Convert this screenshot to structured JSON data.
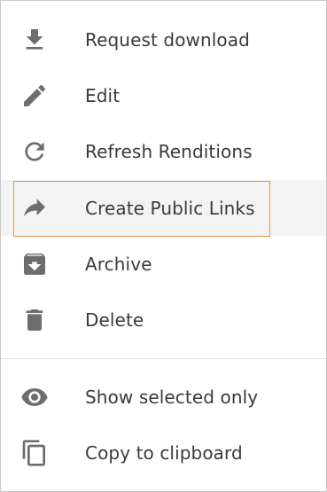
{
  "menu": {
    "items": [
      {
        "label": "Request download",
        "icon": "download-icon"
      },
      {
        "label": "Edit",
        "icon": "pencil-icon"
      },
      {
        "label": "Refresh Renditions",
        "icon": "refresh-icon"
      },
      {
        "label": "Create Public Links",
        "icon": "share-arrow-icon"
      },
      {
        "label": "Archive",
        "icon": "archive-icon"
      },
      {
        "label": "Delete",
        "icon": "trash-icon"
      },
      {
        "label": "Show selected only",
        "icon": "eye-icon"
      },
      {
        "label": "Copy to clipboard",
        "icon": "copy-icon"
      }
    ]
  },
  "colors": {
    "icon": "#6d6d6d",
    "text": "#3a3a3a",
    "highlight_bg": "#f3f3f3",
    "focus_border": "#e4923b"
  }
}
